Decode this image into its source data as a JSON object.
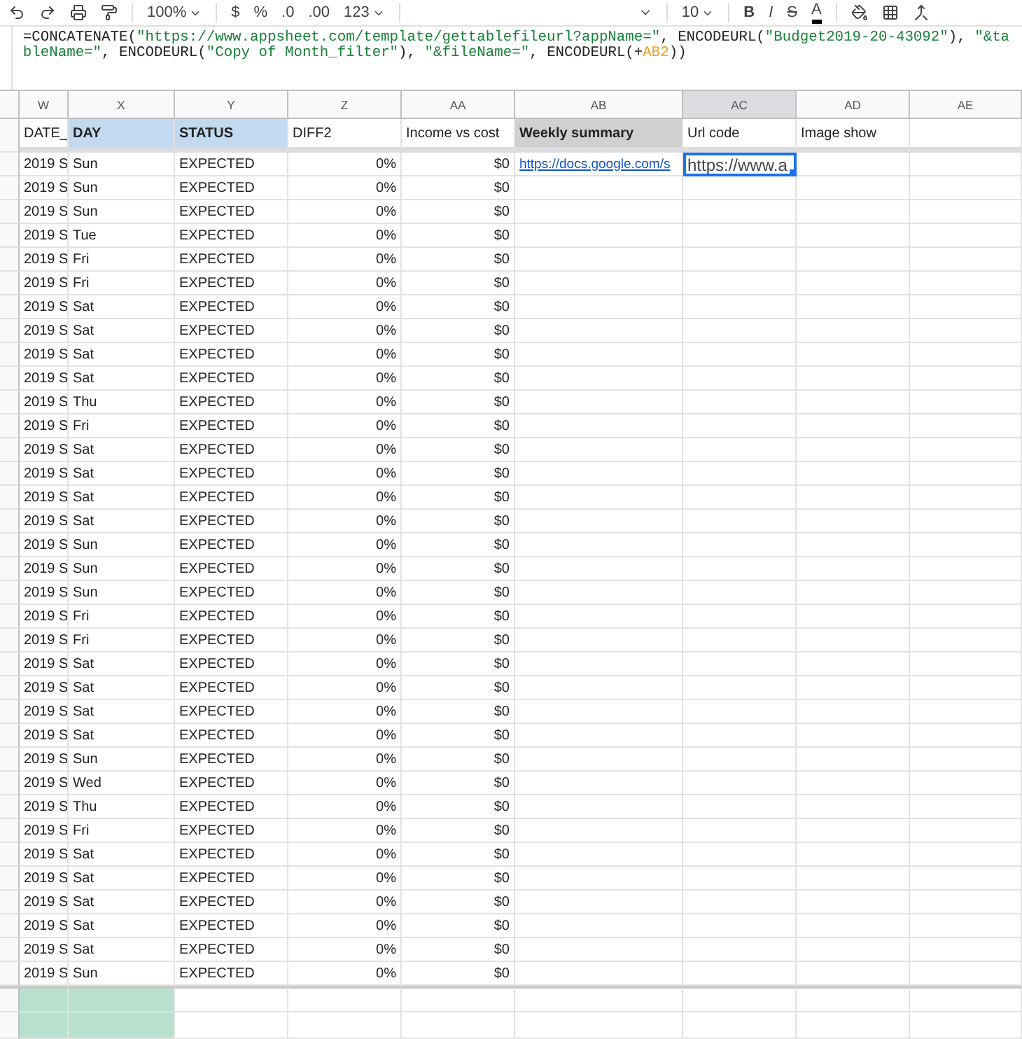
{
  "toolbar": {
    "zoom": "100%",
    "currency": "$",
    "percent": "%",
    "decimal_less": ".0",
    "decimal_more": ".00",
    "number_format": "123",
    "font_size": "10",
    "bold": "B",
    "italic": "I",
    "strike": "S",
    "text_color": "A"
  },
  "formula": [
    {
      "kind": "func",
      "text": "=CONCATENATE("
    },
    {
      "kind": "string",
      "text": "\"https://www.appsheet.com/template/gettablefileurl?appName=\""
    },
    {
      "kind": "func",
      "text": ", ENCODEURL("
    },
    {
      "kind": "string",
      "text": "\"Budget2019-20-43092\""
    },
    {
      "kind": "func",
      "text": "), "
    },
    {
      "kind": "string",
      "text": "\"&tableName=\""
    },
    {
      "kind": "func",
      "text": ", ENCODEURL("
    },
    {
      "kind": "string",
      "text": "\"Copy of Month_filter\""
    },
    {
      "kind": "func",
      "text": "), "
    },
    {
      "kind": "string",
      "text": "\"&fileName=\""
    },
    {
      "kind": "func",
      "text": ", ENCODEURL(+"
    },
    {
      "kind": "ref",
      "text": "AB2"
    },
    {
      "kind": "func",
      "text": "))"
    }
  ],
  "columns": [
    {
      "label": "W",
      "selected": false
    },
    {
      "label": "X",
      "selected": false
    },
    {
      "label": "Y",
      "selected": false
    },
    {
      "label": "Z",
      "selected": false
    },
    {
      "label": "AA",
      "selected": false
    },
    {
      "label": "AB",
      "selected": false
    },
    {
      "label": "AC",
      "selected": true
    },
    {
      "label": "AD",
      "selected": false
    },
    {
      "label": "AE",
      "selected": false
    }
  ],
  "header_cells": [
    {
      "text": "DATE_",
      "kind": "plain"
    },
    {
      "text": "DAY",
      "kind": "selected"
    },
    {
      "text": "STATUS",
      "kind": "selected"
    },
    {
      "text": "DIFF2",
      "kind": "plain"
    },
    {
      "text": "Income vs cost",
      "kind": "plain"
    },
    {
      "text": "Weekly summary",
      "kind": "filtered"
    },
    {
      "text": "Url code",
      "kind": "plain"
    },
    {
      "text": "Image show",
      "kind": "plain"
    }
  ],
  "rows": [
    {
      "date": "2019 S",
      "day": "Sun",
      "status": "EXPECTED",
      "diff": "0%",
      "income": "$0",
      "summary": "https://docs.google.com/s",
      "url": "https://www.a"
    },
    {
      "date": "2019 S",
      "day": "Sun",
      "status": "EXPECTED",
      "diff": "0%",
      "income": "$0"
    },
    {
      "date": "2019 S",
      "day": "Sun",
      "status": "EXPECTED",
      "diff": "0%",
      "income": "$0"
    },
    {
      "date": "2019 S",
      "day": "Tue",
      "status": "EXPECTED",
      "diff": "0%",
      "income": "$0"
    },
    {
      "date": "2019 S",
      "day": "Fri",
      "status": "EXPECTED",
      "diff": "0%",
      "income": "$0"
    },
    {
      "date": "2019 S",
      "day": "Fri",
      "status": "EXPECTED",
      "diff": "0%",
      "income": "$0"
    },
    {
      "date": "2019 S",
      "day": "Sat",
      "status": "EXPECTED",
      "diff": "0%",
      "income": "$0"
    },
    {
      "date": "2019 S",
      "day": "Sat",
      "status": "EXPECTED",
      "diff": "0%",
      "income": "$0"
    },
    {
      "date": "2019 S",
      "day": "Sat",
      "status": "EXPECTED",
      "diff": "0%",
      "income": "$0"
    },
    {
      "date": "2019 S",
      "day": "Sat",
      "status": "EXPECTED",
      "diff": "0%",
      "income": "$0"
    },
    {
      "date": "2019 S",
      "day": "Thu",
      "status": "EXPECTED",
      "diff": "0%",
      "income": "$0"
    },
    {
      "date": "2019 S",
      "day": "Fri",
      "status": "EXPECTED",
      "diff": "0%",
      "income": "$0"
    },
    {
      "date": "2019 S",
      "day": "Sat",
      "status": "EXPECTED",
      "diff": "0%",
      "income": "$0"
    },
    {
      "date": "2019 S",
      "day": "Sat",
      "status": "EXPECTED",
      "diff": "0%",
      "income": "$0"
    },
    {
      "date": "2019 S",
      "day": "Sat",
      "status": "EXPECTED",
      "diff": "0%",
      "income": "$0"
    },
    {
      "date": "2019 S",
      "day": "Sat",
      "status": "EXPECTED",
      "diff": "0%",
      "income": "$0"
    },
    {
      "date": "2019 S",
      "day": "Sun",
      "status": "EXPECTED",
      "diff": "0%",
      "income": "$0"
    },
    {
      "date": "2019 S",
      "day": "Sun",
      "status": "EXPECTED",
      "diff": "0%",
      "income": "$0"
    },
    {
      "date": "2019 S",
      "day": "Sun",
      "status": "EXPECTED",
      "diff": "0%",
      "income": "$0"
    },
    {
      "date": "2019 S",
      "day": "Fri",
      "status": "EXPECTED",
      "diff": "0%",
      "income": "$0"
    },
    {
      "date": "2019 S",
      "day": "Fri",
      "status": "EXPECTED",
      "diff": "0%",
      "income": "$0"
    },
    {
      "date": "2019 S",
      "day": "Sat",
      "status": "EXPECTED",
      "diff": "0%",
      "income": "$0"
    },
    {
      "date": "2019 S",
      "day": "Sat",
      "status": "EXPECTED",
      "diff": "0%",
      "income": "$0"
    },
    {
      "date": "2019 S",
      "day": "Sat",
      "status": "EXPECTED",
      "diff": "0%",
      "income": "$0"
    },
    {
      "date": "2019 S",
      "day": "Sat",
      "status": "EXPECTED",
      "diff": "0%",
      "income": "$0"
    },
    {
      "date": "2019 S",
      "day": "Sun",
      "status": "EXPECTED",
      "diff": "0%",
      "income": "$0"
    },
    {
      "date": "2019 S",
      "day": "Wed",
      "status": "EXPECTED",
      "diff": "0%",
      "income": "$0"
    },
    {
      "date": "2019 S",
      "day": "Thu",
      "status": "EXPECTED",
      "diff": "0%",
      "income": "$0"
    },
    {
      "date": "2019 S",
      "day": "Fri",
      "status": "EXPECTED",
      "diff": "0%",
      "income": "$0"
    },
    {
      "date": "2019 S",
      "day": "Sat",
      "status": "EXPECTED",
      "diff": "0%",
      "income": "$0"
    },
    {
      "date": "2019 S",
      "day": "Sat",
      "status": "EXPECTED",
      "diff": "0%",
      "income": "$0"
    },
    {
      "date": "2019 S",
      "day": "Sat",
      "status": "EXPECTED",
      "diff": "0%",
      "income": "$0"
    },
    {
      "date": "2019 S",
      "day": "Sat",
      "status": "EXPECTED",
      "diff": "0%",
      "income": "$0"
    },
    {
      "date": "2019 S",
      "day": "Sat",
      "status": "EXPECTED",
      "diff": "0%",
      "income": "$0"
    },
    {
      "date": "2019 S",
      "day": "Sun",
      "status": "EXPECTED",
      "diff": "0%",
      "income": "$0"
    }
  ],
  "empty_rows": [
    {
      "selected": true
    },
    {
      "selected": true
    }
  ]
}
